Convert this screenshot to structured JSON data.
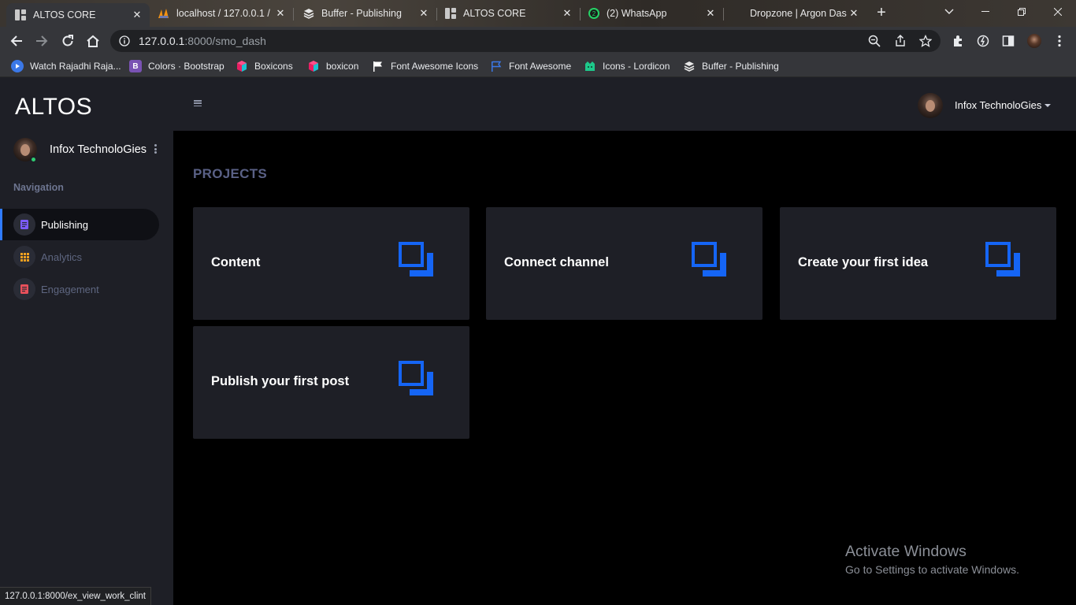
{
  "browser": {
    "tabs": [
      {
        "title": "ALTOS CORE",
        "icon": "grid-icon",
        "active": true
      },
      {
        "title": "localhost / 127.0.0.1 /",
        "icon": "phpmyadmin-icon",
        "active": false
      },
      {
        "title": "Buffer - Publishing",
        "icon": "buffer-stack-icon",
        "active": false
      },
      {
        "title": "ALTOS CORE",
        "icon": "grid-icon",
        "active": false
      },
      {
        "title": "(2) WhatsApp",
        "icon": "whatsapp-icon",
        "badge": "2",
        "active": false
      },
      {
        "title": "Dropzone | Argon Das",
        "icon": "argon-icon",
        "active": false
      }
    ],
    "url_host": "127.0.0.1",
    "url_path": ":8000/smo_dash",
    "bookmarks": [
      {
        "label": "Watch Rajadhi Raja...",
        "icon": "play-icon",
        "color": "#3b78e7"
      },
      {
        "label": "Colors · Bootstrap",
        "icon": "bootstrap-icon",
        "color": "#7952b3",
        "glyph": "B"
      },
      {
        "label": "Boxicons",
        "icon": "boxicons-icon",
        "color": "#e91e63"
      },
      {
        "label": "boxicon",
        "icon": "boxicons-icon",
        "color": "#e91e63"
      },
      {
        "label": "Font Awesome Icons",
        "icon": "flag-icon",
        "color": "#ffffff"
      },
      {
        "label": "Font Awesome",
        "icon": "flag-outline-icon",
        "color": "#3b78e7"
      },
      {
        "label": "Icons - Lordicon",
        "icon": "lordicon-icon",
        "color": "#1ec98b"
      },
      {
        "label": "Buffer - Publishing",
        "icon": "buffer-stack-icon",
        "color": "#ffffff"
      }
    ],
    "status_url": "127.0.0.1:8000/ex_view_work_clint"
  },
  "sidebar": {
    "brand": "ALTOS",
    "profile_name": "Infox TechnoloGies",
    "nav_heading": "Navigation",
    "items": [
      {
        "label": "Publishing",
        "icon": "document-icon",
        "icon_color": "#7c5cff",
        "active": true
      },
      {
        "label": "Analytics",
        "icon": "grid-icon",
        "icon_color": "#f0a020",
        "active": false
      },
      {
        "label": "Engagement",
        "icon": "document-icon",
        "icon_color": "#e8505b",
        "active": false
      }
    ]
  },
  "topbar": {
    "user_name": "Infox TechnoloGies"
  },
  "main": {
    "title": "PROJECTS",
    "cards": [
      {
        "title": "Content",
        "icon": "copy-icon"
      },
      {
        "title": "Connect channel",
        "icon": "copy-icon"
      },
      {
        "title": "Create your first idea",
        "icon": "copy-icon"
      },
      {
        "title": "Publish your first post",
        "icon": "copy-icon"
      }
    ],
    "accent_color": "#1565f5"
  },
  "watermark": {
    "line1": "Activate Windows",
    "line2": "Go to Settings to activate Windows."
  }
}
